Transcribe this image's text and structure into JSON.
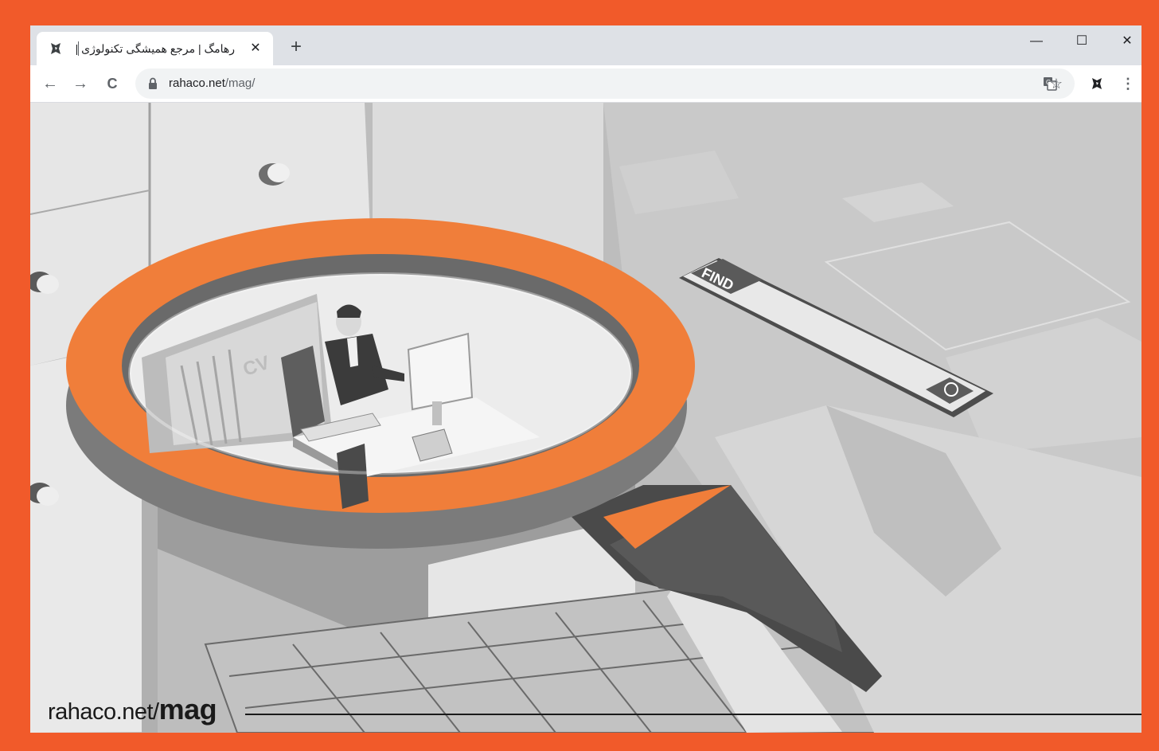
{
  "browser": {
    "tab": {
      "title": "رهامگ | مرجع همیشگی تکنولوژی |",
      "close_label": "✕",
      "favicon": "rahaco-logo-icon"
    },
    "new_tab_label": "+",
    "window_controls": {
      "minimize": "—",
      "maximize": "☐",
      "close": "✕"
    },
    "toolbar": {
      "back": "←",
      "forward": "→",
      "reload": "C",
      "url_host": "rahaco.net",
      "url_path": "/mag/",
      "translate_icon": "translate-icon",
      "bookmark": "☆",
      "extension_icon": "rahaco-extension-icon",
      "menu": "⋮"
    }
  },
  "hero": {
    "search_bar_label": "FIND",
    "folder_label": "CV"
  },
  "caption": {
    "prefix": "rahaco.net/",
    "emphasis": "mag"
  },
  "colors": {
    "frame": "#f15a2a",
    "magnifier": "#f07e3a",
    "chrome": "#dee1e6"
  }
}
